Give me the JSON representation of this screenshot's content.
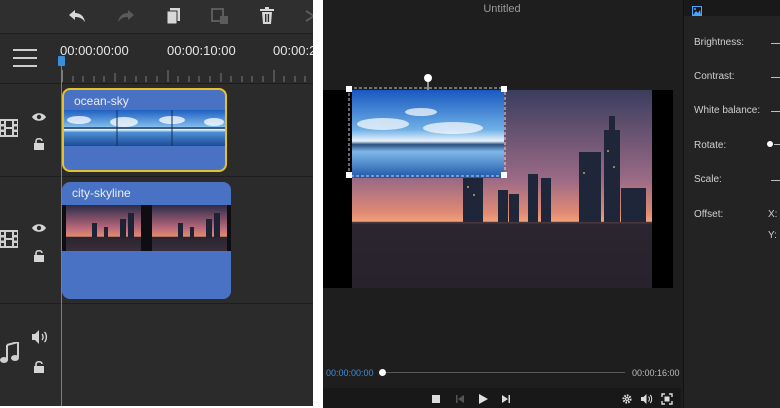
{
  "toolbar": {
    "icons": [
      "undo-icon",
      "redo-icon",
      "copy-icon",
      "split-icon",
      "delete-icon",
      "more-icon"
    ]
  },
  "timeline": {
    "timecodes": [
      "00:00:00:00",
      "00:00:10:00",
      "00:00:2"
    ],
    "tracks": [
      {
        "type": "video",
        "clip_label": "ocean-sky",
        "selected": true
      },
      {
        "type": "video",
        "clip_label": "city-skyline",
        "selected": false
      },
      {
        "type": "audio"
      }
    ],
    "colors": {
      "clip": "#4a72c4",
      "selected_border": "#e7c12a",
      "playhead": "#3a8fd9"
    }
  },
  "preview": {
    "title": "Untitled",
    "current_time": "00:00:00:00",
    "total_time": "00:00:16:00"
  },
  "properties": {
    "brightness_label": "Brightness:",
    "contrast_label": "Contrast:",
    "white_balance_label": "White balance:",
    "rotate_label": "Rotate:",
    "scale_label": "Scale:",
    "offset_label": "Offset:",
    "x_label": "X:",
    "y_label": "Y:"
  }
}
